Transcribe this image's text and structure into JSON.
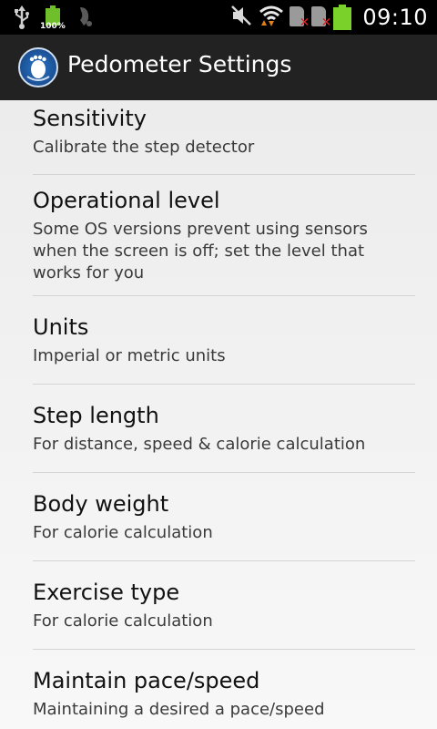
{
  "status_bar": {
    "battery_small_pct": "100%",
    "time": "09:10",
    "icons": [
      "usb-icon",
      "battery-full-icon",
      "running-app-icon",
      "mute-icon",
      "wifi-icon",
      "sim1-no-signal-icon",
      "sim2-no-signal-icon",
      "battery-icon"
    ]
  },
  "action_bar": {
    "title": "Pedometer Settings",
    "app_icon": "pedometer-footprint-icon"
  },
  "settings": [
    {
      "title": "Sensitivity",
      "summary": "Calibrate the step detector"
    },
    {
      "title": "Operational level",
      "summary": "Some OS versions prevent using sensors when the screen is off; set the level that works for you"
    },
    {
      "title": "Units",
      "summary": "Imperial or metric units"
    },
    {
      "title": "Step length",
      "summary": "For distance, speed & calorie calculation"
    },
    {
      "title": "Body weight",
      "summary": "For calorie calculation"
    },
    {
      "title": "Exercise type",
      "summary": "For calorie calculation"
    },
    {
      "title": "Maintain pace/speed",
      "summary": "Maintaining a desired a pace/speed"
    }
  ],
  "colors": {
    "battery_green": "#7ad12a",
    "actionbar_bg": "#222222",
    "list_bg": "#f2f2f2"
  }
}
